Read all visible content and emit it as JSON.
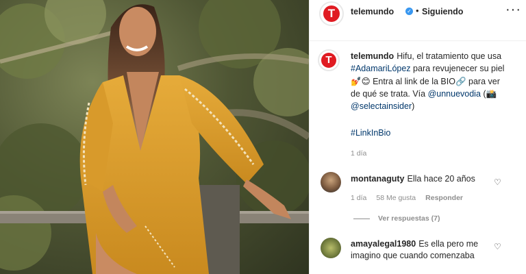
{
  "post": {
    "username": "telemundo",
    "separator": "•",
    "follow_status": "Siguiendo",
    "more": "···",
    "close": "✕",
    "logo_letter": "T"
  },
  "caption": {
    "username": "telemundo",
    "text_1": "Hifu, el tratamiento que usa ",
    "hashtag_1": "#AdamariLópez",
    "text_2": " para revujenecer su piel💅😊 Entra al link de la BIO🔗 para ver de qué se trata. Vía ",
    "mention_1": "@unnuevodia",
    "text_3": " (📸 ",
    "mention_2": "@selectainsider",
    "text_4": ")",
    "hashtag_2": "#LinkInBio",
    "age": "1 día"
  },
  "comments": [
    {
      "username": "montanaguty",
      "text": "Ella hace 20 años",
      "age": "1 día",
      "likes": "58 Me gusta",
      "reply": "Responder",
      "view_replies": "Ver respuestas (7)"
    },
    {
      "username": "amayalegal1980",
      "text": "Es ella pero me imagino que cuando comenzaba"
    }
  ],
  "icons": {
    "heart": "♡",
    "verified": "✓"
  },
  "colors": {
    "brand_red": "#e01b22",
    "link_blue": "#00376b",
    "verified_blue": "#3897f0",
    "muted": "#8e8e8e"
  }
}
